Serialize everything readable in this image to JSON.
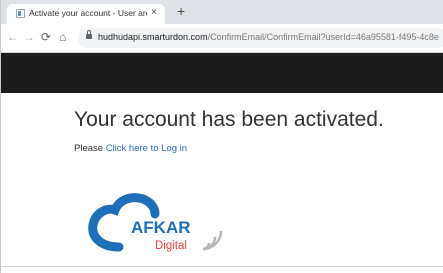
{
  "browser": {
    "tab_title": "Activate your account - User area",
    "tab_close": "×",
    "new_tab": "+",
    "nav": {
      "back": "←",
      "forward": "→",
      "reload": "⟳",
      "home": "⌂"
    },
    "url_host": "hudhudapi.smarturdon.com",
    "url_path": "/ConfirmEmail/ConfirmEmail?userId=46a95581-f495-4c8e",
    "icons": {
      "favicon": "document-icon",
      "lock": "lock-icon"
    }
  },
  "page": {
    "header_color": "#1b1b1b",
    "headline": "Your account has been activated.",
    "login_prefix": "Please",
    "login_link": "Click here to Log in",
    "link_color": "#2a6ebb"
  },
  "logo": {
    "word": "AFKAR",
    "sub": "Digital",
    "colors": {
      "cloud": "#1f6fb8",
      "word": "#1f6fb8",
      "sub": "#e0463a",
      "signal": "#b5b5b5"
    }
  }
}
